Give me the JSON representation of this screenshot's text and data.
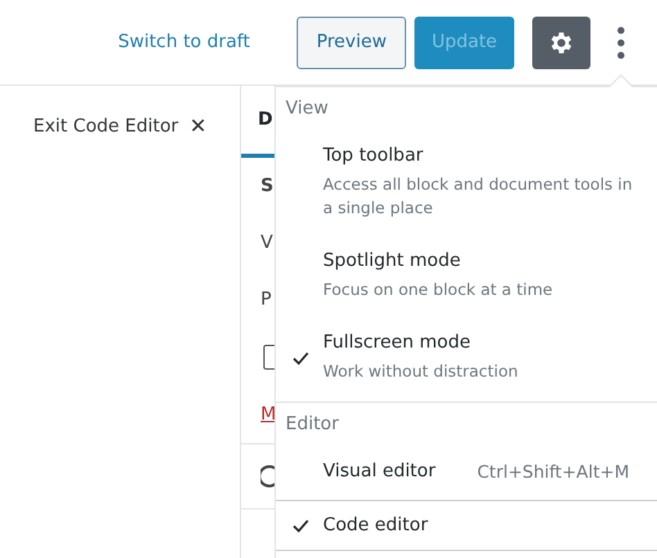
{
  "header": {
    "switch_link": "Switch to draft",
    "preview_button": "Preview",
    "update_button": {
      "label": "Update",
      "disabled": true
    }
  },
  "exit_button": {
    "label": "Exit Code Editor",
    "close": "✕"
  },
  "sidebar": {
    "tab": {
      "label": "D",
      "selected": true
    },
    "rows": [
      {
        "kind": "heading",
        "text": "S"
      },
      {
        "kind": "text",
        "text": "V"
      },
      {
        "kind": "text",
        "text": "P"
      },
      {
        "kind": "checkbox",
        "checked": false
      },
      {
        "kind": "link",
        "text": "M"
      },
      {
        "kind": "icon"
      }
    ]
  },
  "menu": {
    "groups": [
      {
        "title": "View",
        "items": [
          {
            "label": "Top toolbar",
            "description": "Access all block and document tools in a single place",
            "checked": false,
            "focused": false
          },
          {
            "label": "Spotlight mode",
            "description": "Focus on one block at a time",
            "checked": false,
            "focused": false
          },
          {
            "label": "Fullscreen mode",
            "description": "Work without distraction",
            "checked": true,
            "focused": false
          }
        ]
      },
      {
        "title": "Editor",
        "items": [
          {
            "label": "Visual editor",
            "shortcut": "Ctrl+Shift+Alt+M",
            "checked": false,
            "focused": false
          },
          {
            "label": "Code editor",
            "checked": true,
            "focused": true
          }
        ]
      }
    ]
  }
}
